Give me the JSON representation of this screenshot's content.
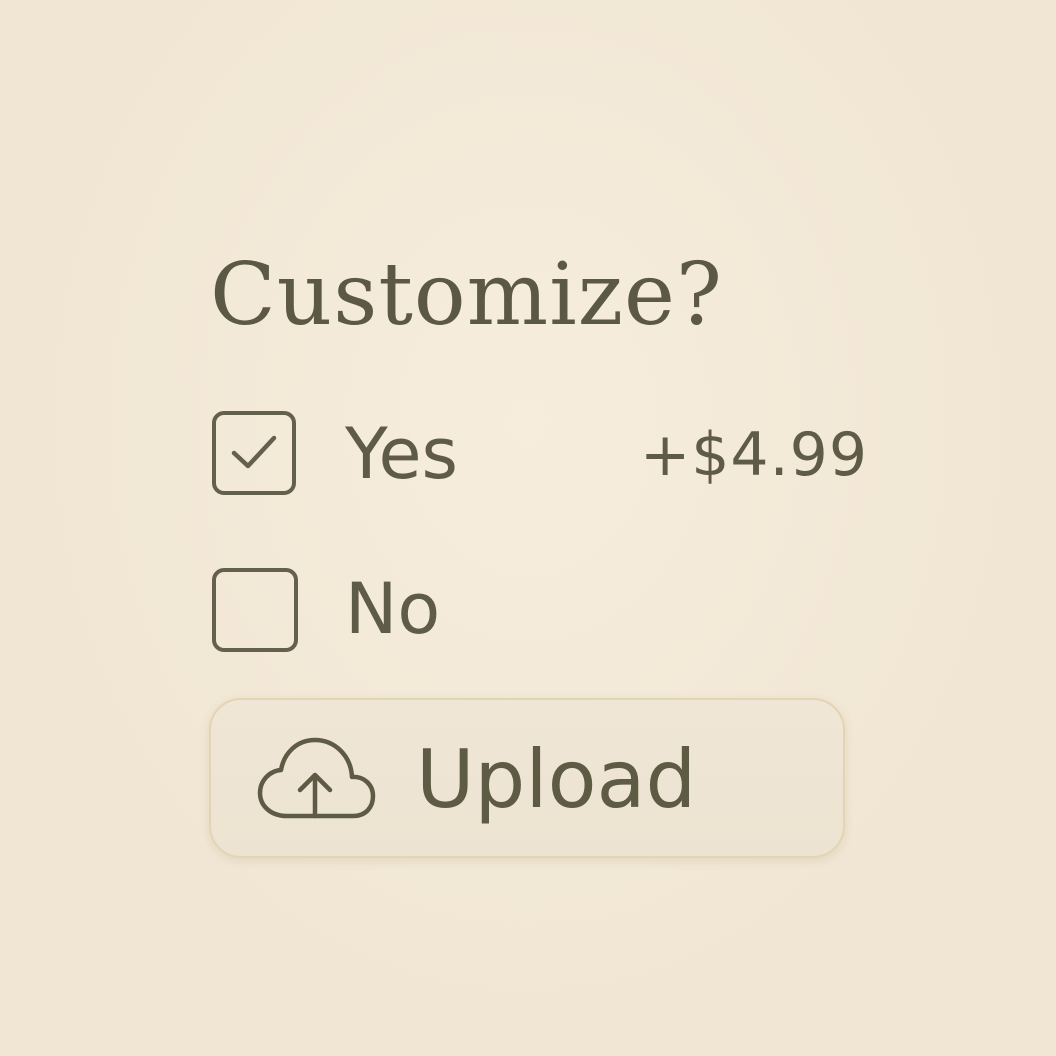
{
  "heading": "Customize?",
  "options": [
    {
      "label": "Yes",
      "price": "+$4.99",
      "checked": true
    },
    {
      "label": "No",
      "checked": false
    }
  ],
  "upload": {
    "label": "Upload",
    "icon": "cloud-upload-icon"
  },
  "icons": {
    "checkmark": "checkmark-icon"
  },
  "colors": {
    "background": "#f1e6d3",
    "text": "#5c5a45",
    "button_border": "#e3d4b4",
    "button_fill": "#ede3d1"
  }
}
